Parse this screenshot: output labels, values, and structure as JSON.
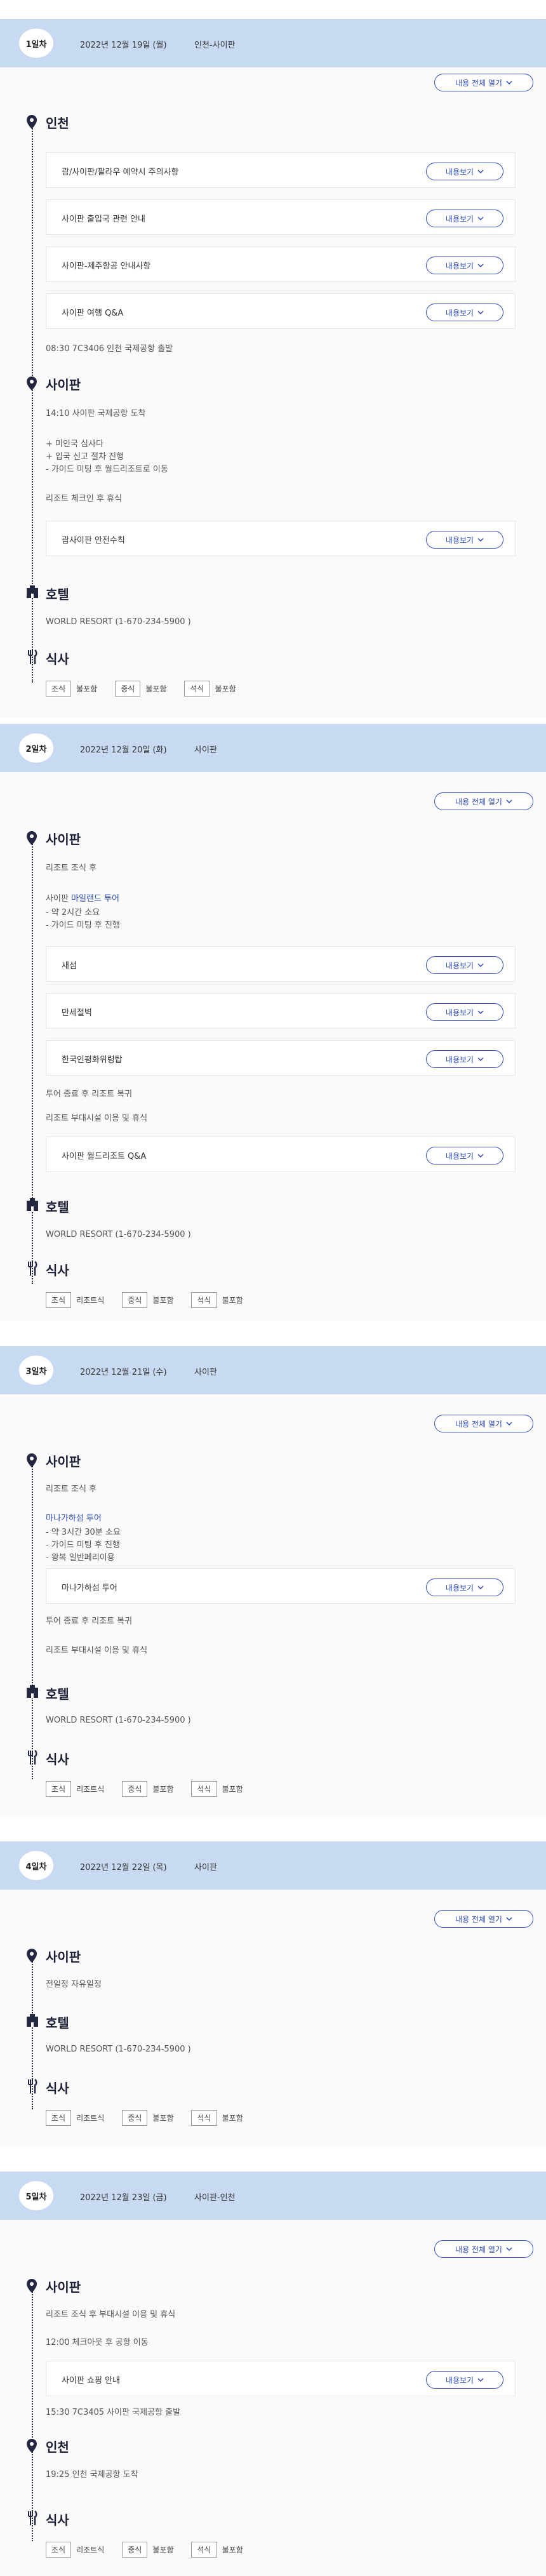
{
  "common": {
    "expand_all": "내용 전체 열기",
    "view_more": "내용보기",
    "hotel_title": "호텔",
    "meal_title": "식사",
    "breakfast": "조식",
    "lunch": "중식",
    "dinner": "석식",
    "hotel_info": "WORLD RESORT (1-670-234-5900 )"
  },
  "days": [
    {
      "badge": "1일차",
      "date": "2022년 12월 19일 (월)",
      "place": "인천-사이판",
      "sec1": "인천",
      "cards1": [
        "괌/사이판/팔라우 예약시 주의사항",
        "사이판 출입국 관련 안내",
        "사이판-제주항공 안내사항",
        "사이판 여행 Q&A"
      ],
      "note1": "08:30 7C3406 인천 국제공항 출발",
      "sec2": "사이판",
      "info2": "14:10 사이판 국제공항 도착",
      "info3": "+ 미인국 심사다\n+ 입국 신고 절차 진행\n- 가이드 미팅 후 월드리조트로 이동",
      "info4": "리조트 체크인 후 휴식",
      "card2": "괌사이판 안전수칙",
      "meals": [
        "불포함",
        "불포함",
        "불포함"
      ]
    },
    {
      "badge": "2일차",
      "date": "2022년 12월 20일 (화)",
      "place": "사이판",
      "sec1": "사이판",
      "info1": "리조트 조식 후",
      "info2_pre": "사이판 ",
      "info2_link": "마일랜드 투어",
      "info3": "- 약 2시간 소요\n- 가이드 미팅 후 진행",
      "cards": [
        "새섬",
        "만세절벽",
        "한국인평화위령탑"
      ],
      "info4": "투어 종료 후 리조트 복귀",
      "info5": "리조트 부대시설 이용 및 휴식",
      "card4": "사이판 월드리조트 Q&A",
      "meals": [
        "리조트식",
        "불포함",
        "불포함"
      ]
    },
    {
      "badge": "3일차",
      "date": "2022년 12월 21일 (수)",
      "place": "사이판",
      "sec1": "사이판",
      "info1": "리조트 조식 후",
      "info2": "마나가하섬 투어",
      "info3": "- 약 3시간 30분 소요\n- 가이드 미팅 후 진행\n- 왕복 일반페리이용",
      "card": "마나가하섬 투어",
      "info4": "투어 종료 후 리조트 복귀",
      "info5": "리조트 부대시설 이용 및 휴식",
      "meals": [
        "리조트식",
        "불포함",
        "불포함"
      ]
    },
    {
      "badge": "4일차",
      "date": "2022년 12월 22일 (목)",
      "place": "사이판",
      "sec1": "사이판",
      "info1": "전일정 자유일정",
      "meals": [
        "리조트식",
        "불포함",
        "불포함"
      ]
    },
    {
      "badge": "5일차",
      "date": "2022년 12월 23일 (금)",
      "place": "사이판-인천",
      "sec1": "사이판",
      "info1": "리조트 조식 후 부대시설 이용 및 휴식",
      "info2": "12:00 체크아웃 후 공항 이동",
      "card": "사이판 쇼핑 안내",
      "info3": "15:30 7C3405 사이판 국제공항 출발",
      "sec2": "인천",
      "info4": "19:25 인천 국제공항 도착",
      "meals": [
        "리조트식",
        "불포함",
        "불포함"
      ]
    }
  ],
  "colors": {
    "header_bg": "#c8daf2",
    "accent": "#2f4cbd",
    "timeline": "#23273f"
  }
}
